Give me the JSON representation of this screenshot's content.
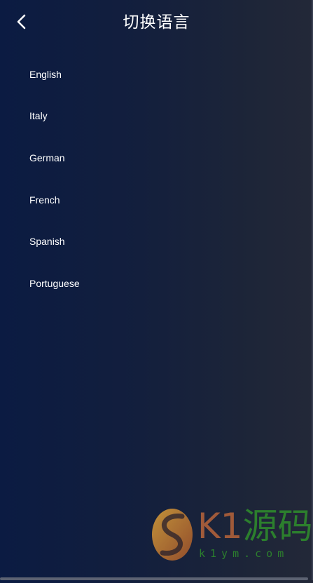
{
  "header": {
    "title": "切换语言",
    "back_icon": "chevron-left-icon"
  },
  "languages": [
    {
      "label": "English"
    },
    {
      "label": "Italy"
    },
    {
      "label": "German"
    },
    {
      "label": "French"
    },
    {
      "label": "Spanish"
    },
    {
      "label": "Portuguese"
    }
  ],
  "watermark": {
    "brand_latin": "K1",
    "brand_cn": "源码",
    "domain": "k1ym.com"
  },
  "colors": {
    "background_start": "#0b1b42",
    "background_end": "#232838",
    "text": "#ffffff",
    "watermark_orange": "#b8643a",
    "watermark_green": "#2f8f2c"
  }
}
